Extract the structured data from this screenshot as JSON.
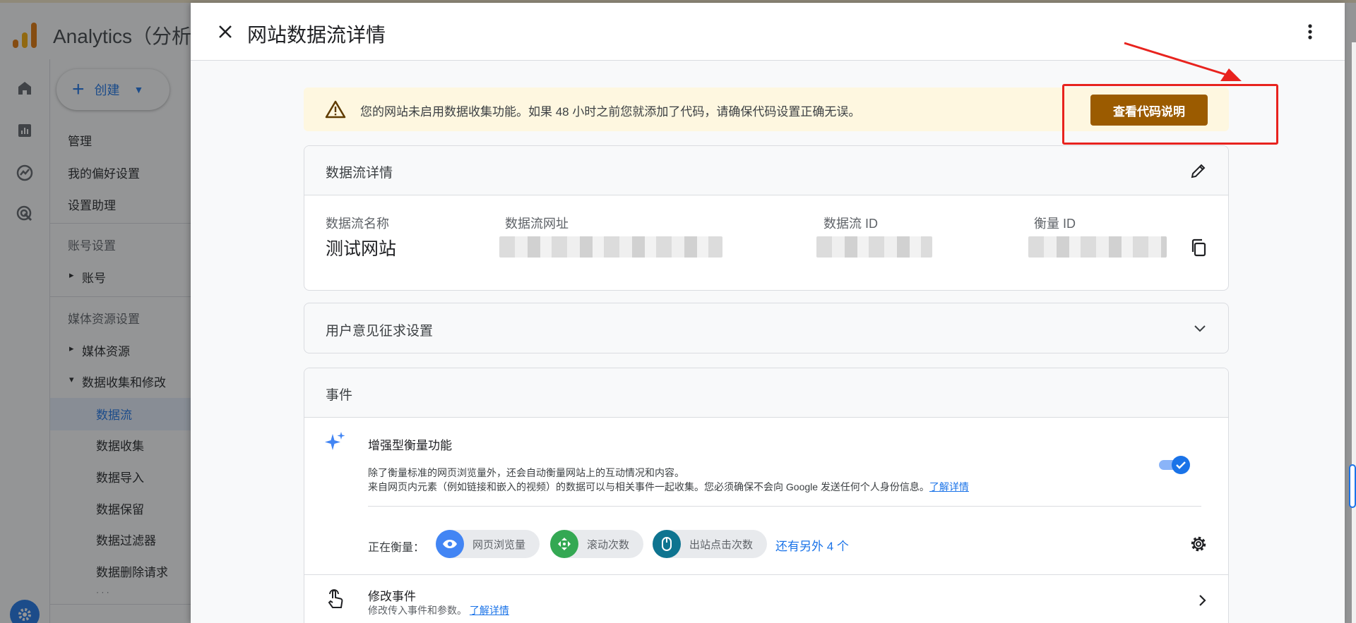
{
  "app": {
    "title": "Analytics（分析",
    "create_label": "创建",
    "nav": {
      "admin": "管理",
      "preferences": "我的偏好设置",
      "setup_assistant": "设置助理",
      "account_settings": "账号设置",
      "account": "账号",
      "property_settings": "媒体资源设置",
      "property": "媒体资源",
      "data_collection_modify": "数据收集和修改",
      "data_streams": "数据流",
      "data_collection": "数据收集",
      "data_import": "数据导入",
      "data_retention": "数据保留",
      "data_filters": "数据过滤器",
      "data_deletion": "数据删除请求",
      "more": "· · ·"
    }
  },
  "drawer": {
    "title": "网站数据流详情",
    "banner": {
      "text": "您的网站未启用数据收集功能。如果 48 小时之前您就添加了代码，请确保代码设置正确无误。",
      "button": "查看代码说明"
    },
    "stream_card": {
      "title": "数据流详情",
      "name_label": "数据流名称",
      "name_value": "测试网站",
      "url_label": "数据流网址",
      "id_label": "数据流 ID",
      "measurement_label": "衡量 ID"
    },
    "consent_card": {
      "title": "用户意见征求设置"
    },
    "events_card": {
      "title": "事件",
      "enhanced_title": "增强型衡量功能",
      "enhanced_desc1": "除了衡量标准的网页浏览量外，还会自动衡量网站上的互动情况和内容。",
      "enhanced_desc2": "来自网页内元素（例如链接和嵌入的视频）的数据可以与相关事件一起收集。您必须确保不会向 Google 发送任何个人身份信息。",
      "learn_more": "了解详情",
      "measuring_label": "正在衡量：",
      "chips": [
        {
          "label": "网页浏览量",
          "icon": "eye-icon",
          "color": "#4285f4"
        },
        {
          "label": "滚动次数",
          "icon": "scroll-icon",
          "color": "#34a853"
        },
        {
          "label": "出站点击次数",
          "icon": "mouse-icon",
          "color": "#12b5cb"
        }
      ],
      "more_chips": "还有另外 4 个",
      "modify_title": "修改事件",
      "modify_desc": "修改传入事件和参数。",
      "modify_learn_more": "了解详情"
    }
  },
  "colors": {
    "primary": "#1a73e8",
    "warning_bg": "#fef7e0",
    "warning_button": "#9b5b00",
    "annotation": "#e8231e"
  }
}
